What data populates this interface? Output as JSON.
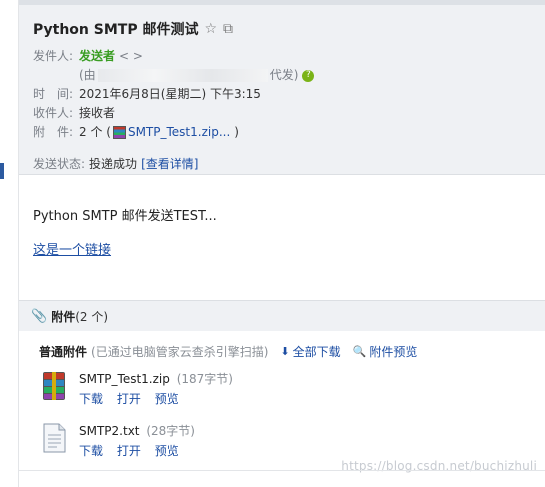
{
  "subject": "Python SMTP 邮件测试",
  "labels": {
    "from": "发件人:",
    "time": "时　间:",
    "to": "收件人:",
    "attachments": "附　件:",
    "send_status": "发送状态:"
  },
  "from": {
    "name": "发送者",
    "angle": "< >",
    "proxy_prefix": "(由",
    "proxy_suffix": "代发)"
  },
  "time": "2021年6月8日(星期二) 下午3:15",
  "to": "接收者",
  "attachment_summary": {
    "prefix": "2 个 (",
    "file": "SMTP_Test1.zip...",
    "suffix": ")"
  },
  "status": {
    "value": "投递成功",
    "detail": "[查看详情]"
  },
  "body": {
    "text": "Python SMTP 邮件发送TEST...",
    "link": "这是一个链接"
  },
  "attach_panel": {
    "title": "附件",
    "count": "(2 个)",
    "section": "普通附件",
    "note": "(已通过电脑管家云查杀引擎扫描)",
    "download_all": "全部下载",
    "preview_all": "附件预览",
    "files": [
      {
        "name": "SMTP_Test1.zip",
        "size": "(187字节)",
        "ops": [
          "下载",
          "打开",
          "预览"
        ]
      },
      {
        "name": "SMTP2.txt",
        "size": "(28字节)",
        "ops": [
          "下载",
          "打开",
          "预览"
        ]
      }
    ]
  },
  "watermark": "https://blog.csdn.net/buchizhuli"
}
